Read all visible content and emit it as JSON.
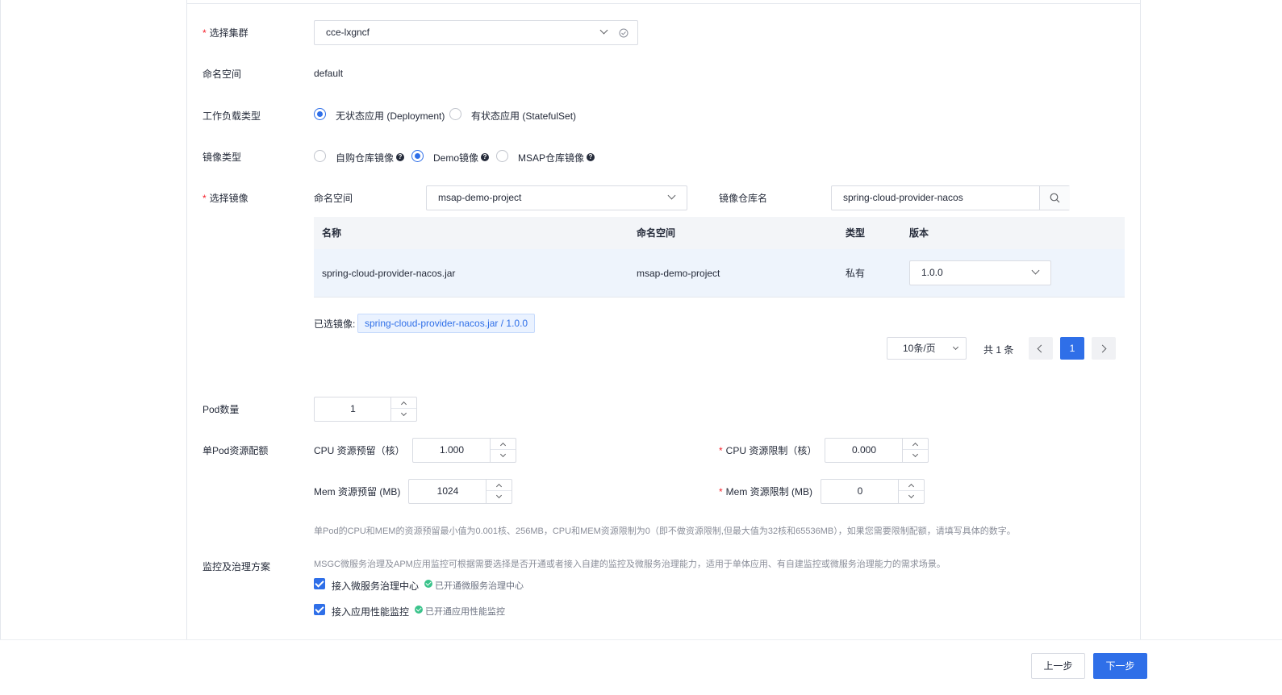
{
  "form": {
    "cluster": {
      "label": "选择集群",
      "value": "cce-lxgncf"
    },
    "namespace": {
      "label": "命名空间",
      "value": "default"
    },
    "workload_type": {
      "label": "工作负载类型",
      "options": [
        "无状态应用 (Deployment)",
        "有状态应用 (StatefulSet)"
      ],
      "selected": "无状态应用 (Deployment)"
    },
    "image_type": {
      "label": "镜像类型",
      "options": [
        "自购仓库镜像",
        "Demo镜像",
        "MSAP仓库镜像"
      ],
      "selected": "Demo镜像"
    },
    "image_select": {
      "label": "选择镜像",
      "namespace_label": "命名空间",
      "namespace_value": "msap-demo-project",
      "repo_label": "镜像仓库名",
      "repo_value": "spring-cloud-provider-nacos"
    },
    "table": {
      "headers": [
        "名称",
        "命名空间",
        "类型",
        "版本"
      ],
      "rows": [
        {
          "name": "spring-cloud-provider-nacos.jar",
          "namespace": "msap-demo-project",
          "type": "私有",
          "version": "1.0.0"
        }
      ]
    },
    "selected_image": {
      "label": "已选镜像:",
      "value": "spring-cloud-provider-nacos.jar / 1.0.0"
    },
    "pagination": {
      "page_size": "10条/页",
      "total": "共 1 条",
      "current": "1"
    },
    "pod_count": {
      "label": "Pod数量",
      "value": "1"
    },
    "resources": {
      "label": "单Pod资源配额",
      "cpu_request_label": "CPU 资源预留（核）",
      "cpu_request": "1.000",
      "cpu_limit_label": "CPU 资源限制（核）",
      "cpu_limit": "0.000",
      "mem_request_label": "Mem 资源预留 (MB)",
      "mem_request": "1024",
      "mem_limit_label": "Mem 资源限制 (MB)",
      "mem_limit": "0",
      "note": "单Pod的CPU和MEM的资源预留最小值为0.001核、256MB，CPU和MEM资源限制为0（即不做资源限制,但最大值为32核和65536MB），如果您需要限制配额，请填写具体的数字。"
    },
    "monitoring": {
      "label": "监控及治理方案",
      "note": "MSGC微服务治理及APM应用监控可根据需要选择是否开通或者接入自建的监控及微服务治理能力，适用于单体应用、有自建监控或微服务治理能力的需求场景。",
      "msgc_label": "接入微服务治理中心",
      "msgc_status": "已开通微服务治理中心",
      "apm_label": "接入应用性能监控",
      "apm_status": "已开通应用性能监控"
    }
  },
  "footer": {
    "prev_label": "上一步",
    "next_label": "下一步"
  },
  "colors": {
    "primary": "#2f6fe8",
    "required": "#f5222d",
    "success": "#3ac38b"
  },
  "icons": [
    "chevron-down-icon",
    "clear-icon",
    "help-icon",
    "search-icon",
    "chevron-left-icon",
    "chevron-right-icon",
    "check-icon"
  ]
}
